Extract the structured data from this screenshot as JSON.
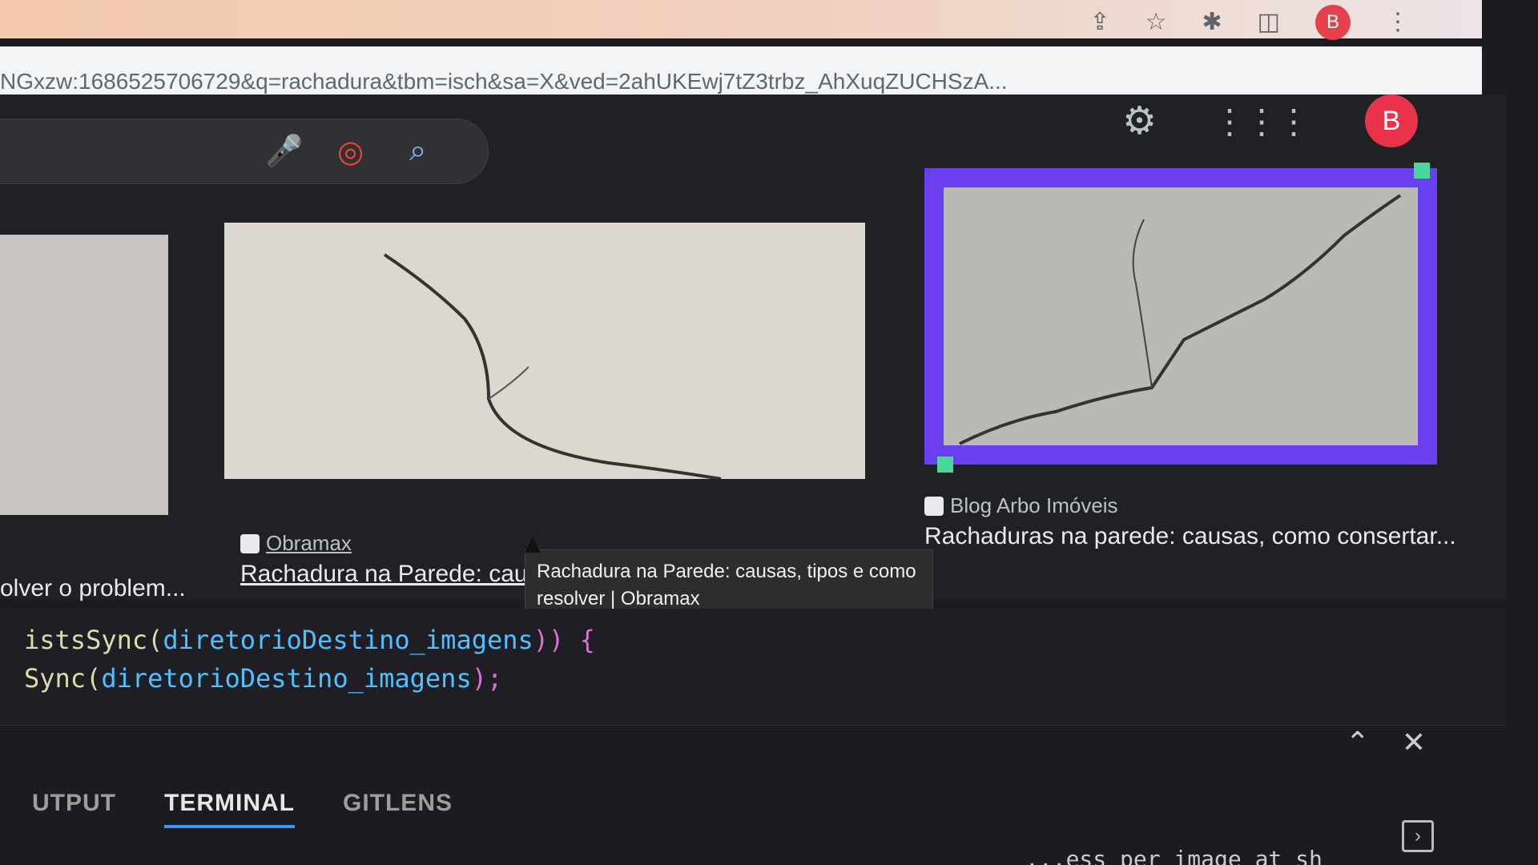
{
  "browser": {
    "url_truncated": "NGxzw:1686525706729&q=rachadura&tbm=isch&sa=X&ved=2ahUKEwj7tZ3trbz_AhXuqZUCHSzA...",
    "toolbar_icons": [
      "share-icon",
      "star-icon",
      "extensions-icon",
      "sidebar-icon"
    ],
    "profile_initial": "B"
  },
  "google": {
    "profile_initial": "B",
    "results": [
      {
        "title": "olver o problem...",
        "source": ""
      },
      {
        "source": "Obramax",
        "title": "Rachadura na Parede: causas, tipos e como resolver | O",
        "tooltip": "Rachadura na Parede: causas, tipos e como resolver | Obramax"
      },
      {
        "source": "Blog Arbo Imóveis",
        "title": "Rachaduras na parede: causas, como consertar..."
      }
    ]
  },
  "editor": {
    "line1_fn": "istsSync(",
    "line1_var": "diretorioDestino_imagens",
    "line1_tail": ")) {",
    "line2_fn": "Sync(",
    "line2_var": "diretorioDestino_imagens",
    "line2_tail": ");"
  },
  "panel": {
    "tabs": [
      "UTPUT",
      "TERMINAL",
      "GITLENS"
    ],
    "active_tab": "TERMINAL",
    "terminal_text": "...ess per image at sh"
  },
  "colors": {
    "selection_border": "#6a3ff0",
    "avatar": "#e8334a",
    "terminal_tab_underline": "#3794ff"
  }
}
